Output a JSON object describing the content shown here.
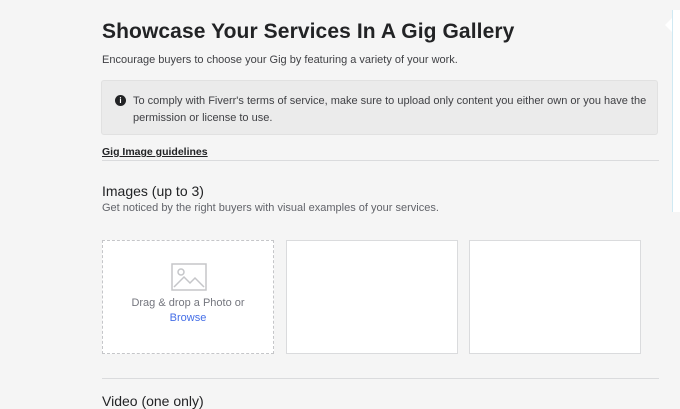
{
  "header": {
    "title": "Showcase Your Services In A Gig Gallery",
    "subtitle": "Encourage buyers to choose your Gig by featuring a variety of your work."
  },
  "notice": {
    "icon": "info-icon",
    "text": "To comply with Fiverr's terms of service, make sure to upload only content you either own or you have the permission or license to use."
  },
  "guidelines_link": "Gig Image guidelines",
  "images_section": {
    "title": "Images (up to 3)",
    "description": "Get noticed by the right buyers with visual examples of your services.",
    "upload_slot": {
      "icon": "image-placeholder-icon",
      "drag_text": "Drag & drop a Photo or",
      "browse_label": "Browse"
    },
    "slot_count": 3
  },
  "video_section": {
    "title": "Video (one only)"
  },
  "colors": {
    "link": "#446ee7",
    "background": "#f5f5f5",
    "notice_bg": "#ebebeb"
  }
}
